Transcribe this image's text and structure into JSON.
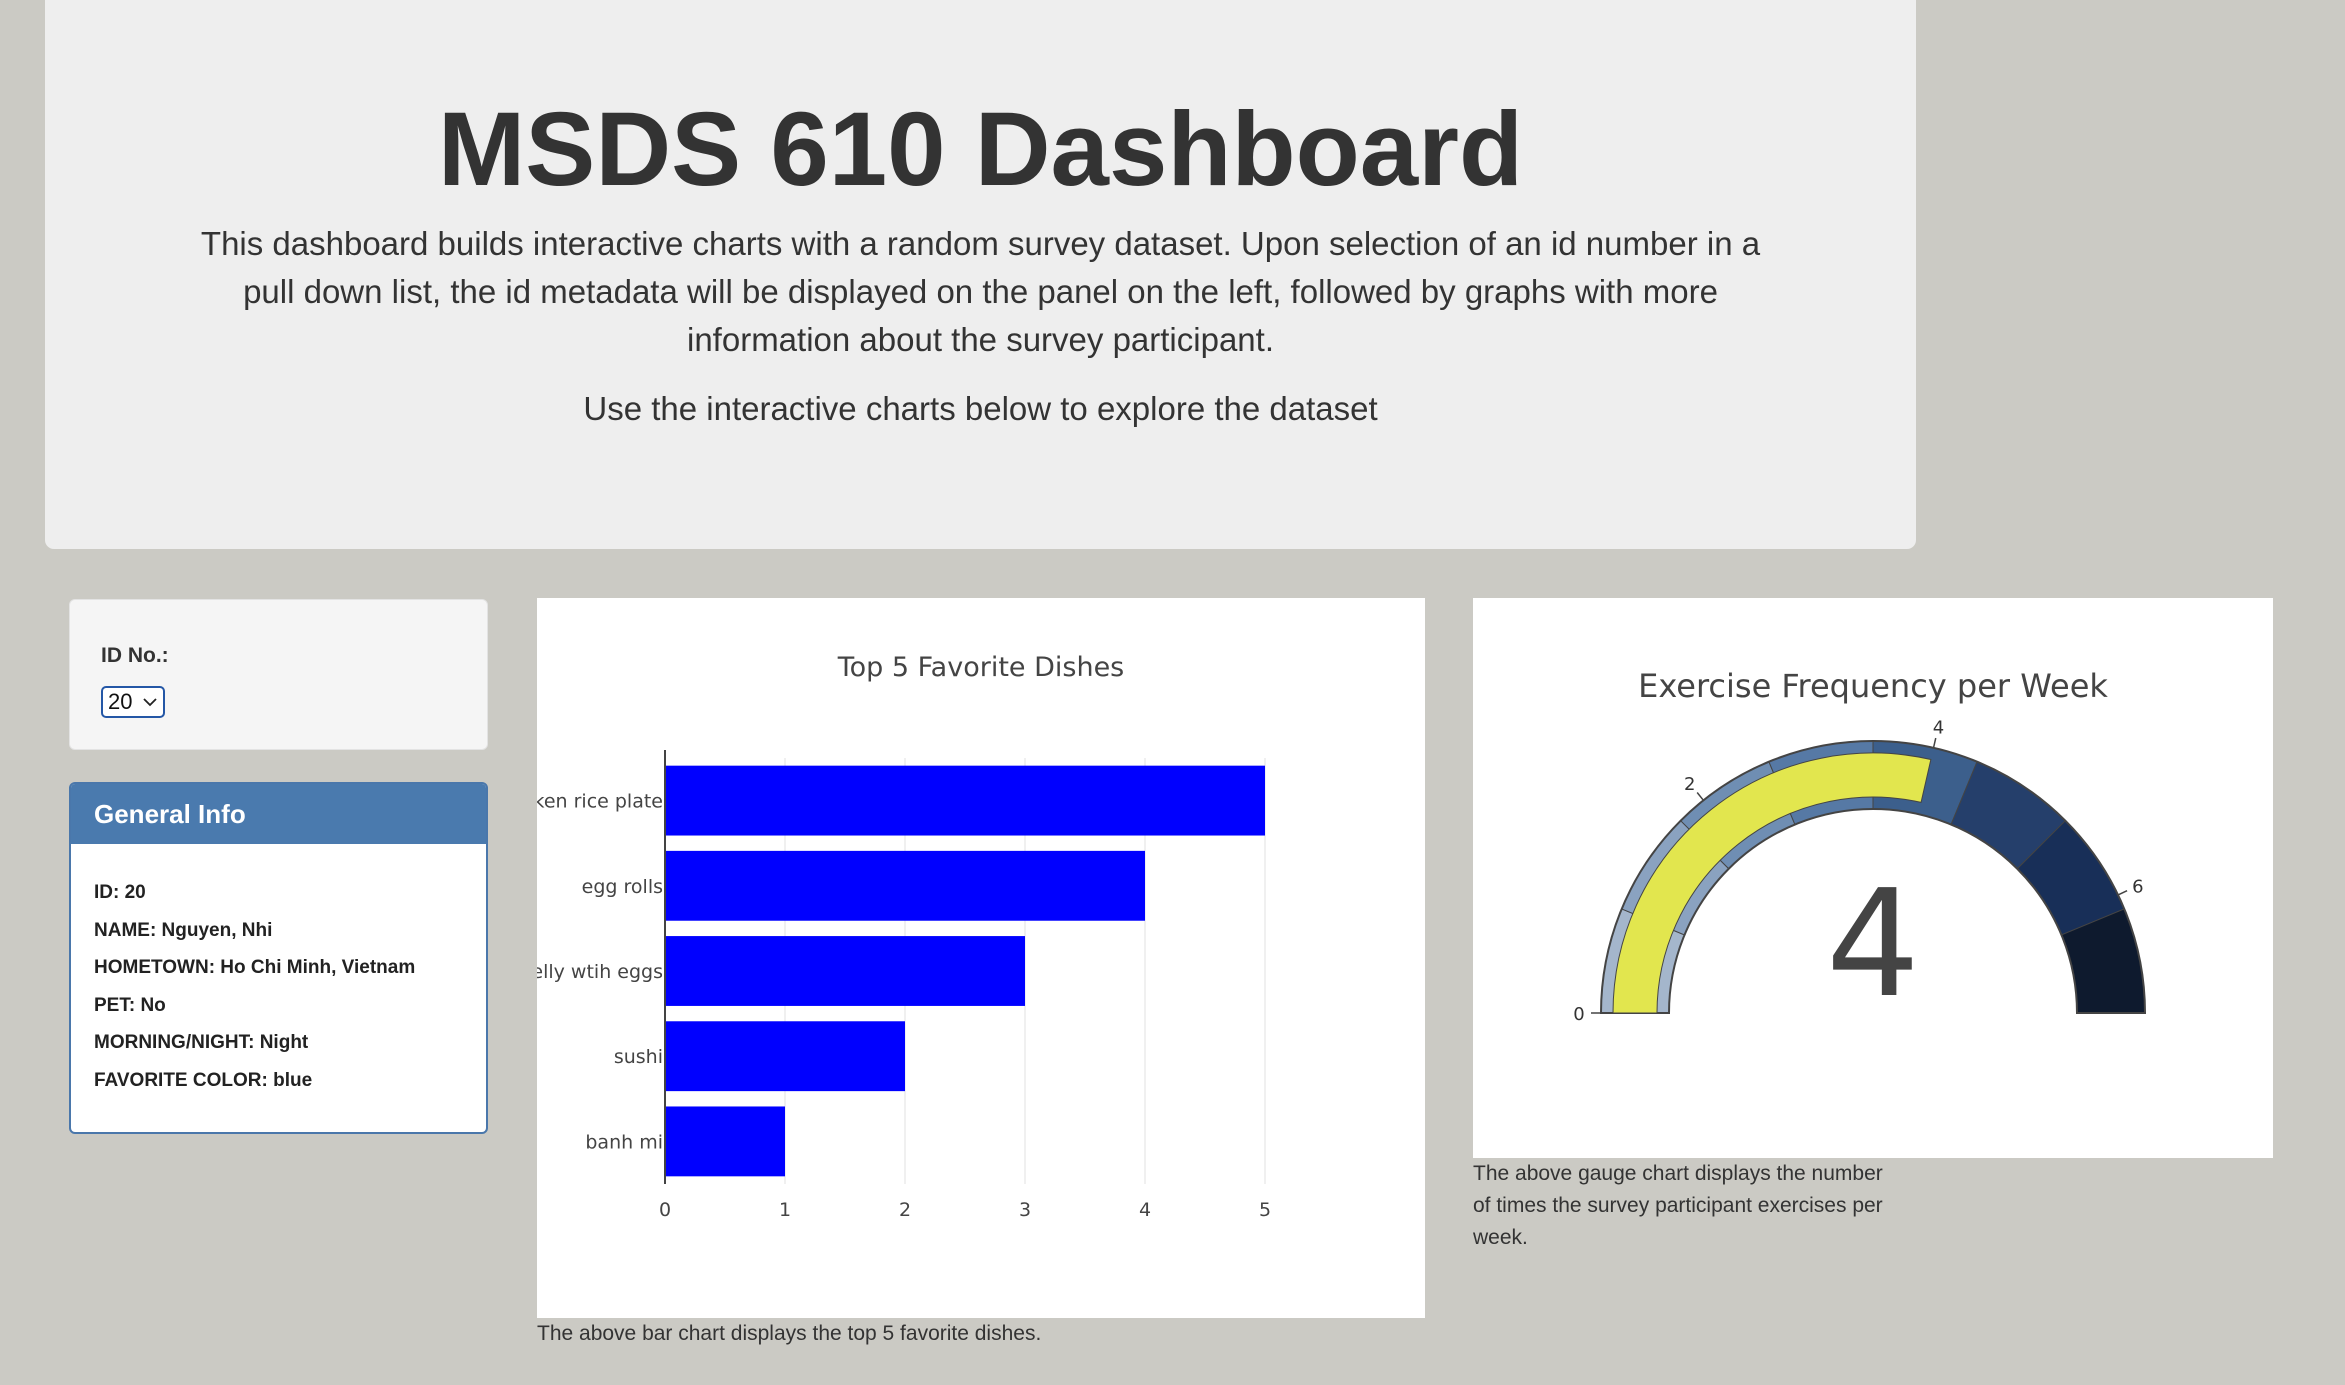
{
  "header": {
    "title": "MSDS 610 Dashboard",
    "description": "This dashboard builds interactive charts with a random survey dataset. Upon selection of an id number in a pull down list, the id metadata will be displayed on the panel on the left, followed by graphs with more information about the survey participant.",
    "subtitle": "Use the interactive charts below to explore the dataset"
  },
  "selector": {
    "label": "ID No.:",
    "selected": "20"
  },
  "info_panel": {
    "title": "General Info",
    "lines": [
      "ID: 20",
      "NAME: Nguyen, Nhi",
      "HOMETOWN: Ho Chi Minh, Vietnam",
      "PET: No",
      "MORNING/NIGHT: Night",
      "FAVORITE COLOR: blue"
    ]
  },
  "captions": {
    "bar": "The above bar chart displays the top 5 favorite dishes.",
    "gauge": "The above gauge chart displays the number of times the survey participant exercises per week."
  },
  "colors": {
    "bar": "#0000ff",
    "gauge_value": "#e2e64e",
    "page_bg": "#cbcac4",
    "panel_head": "#4a7aae"
  },
  "chart_data": [
    {
      "type": "bar",
      "orientation": "horizontal",
      "title": "Top 5 Favorite Dishes",
      "categories": [
        "broken rice plate",
        "egg rolls",
        "pork belly wtih eggs",
        "sushi",
        "banh mi"
      ],
      "tick_labels": [
        "oken rice plate",
        "egg rolls",
        "belly wtih eggs",
        "sushi",
        "banh mi"
      ],
      "values": [
        5,
        4,
        3,
        2,
        1
      ],
      "xlim": [
        0,
        5
      ],
      "xticks": [
        0,
        1,
        2,
        3,
        4,
        5
      ],
      "grid": true
    },
    {
      "type": "gauge",
      "title": "Exercise Frequency per Week",
      "value": 4,
      "range": [
        0,
        7
      ],
      "ticks": [
        0,
        2,
        4,
        6
      ],
      "step_colors": [
        "#a4b6cc",
        "#8aa2c0",
        "#6f8eb3",
        "#5679a5",
        "#3c5f8c",
        "#253f6b",
        "#182f58",
        "#0e1a2e"
      ]
    }
  ]
}
